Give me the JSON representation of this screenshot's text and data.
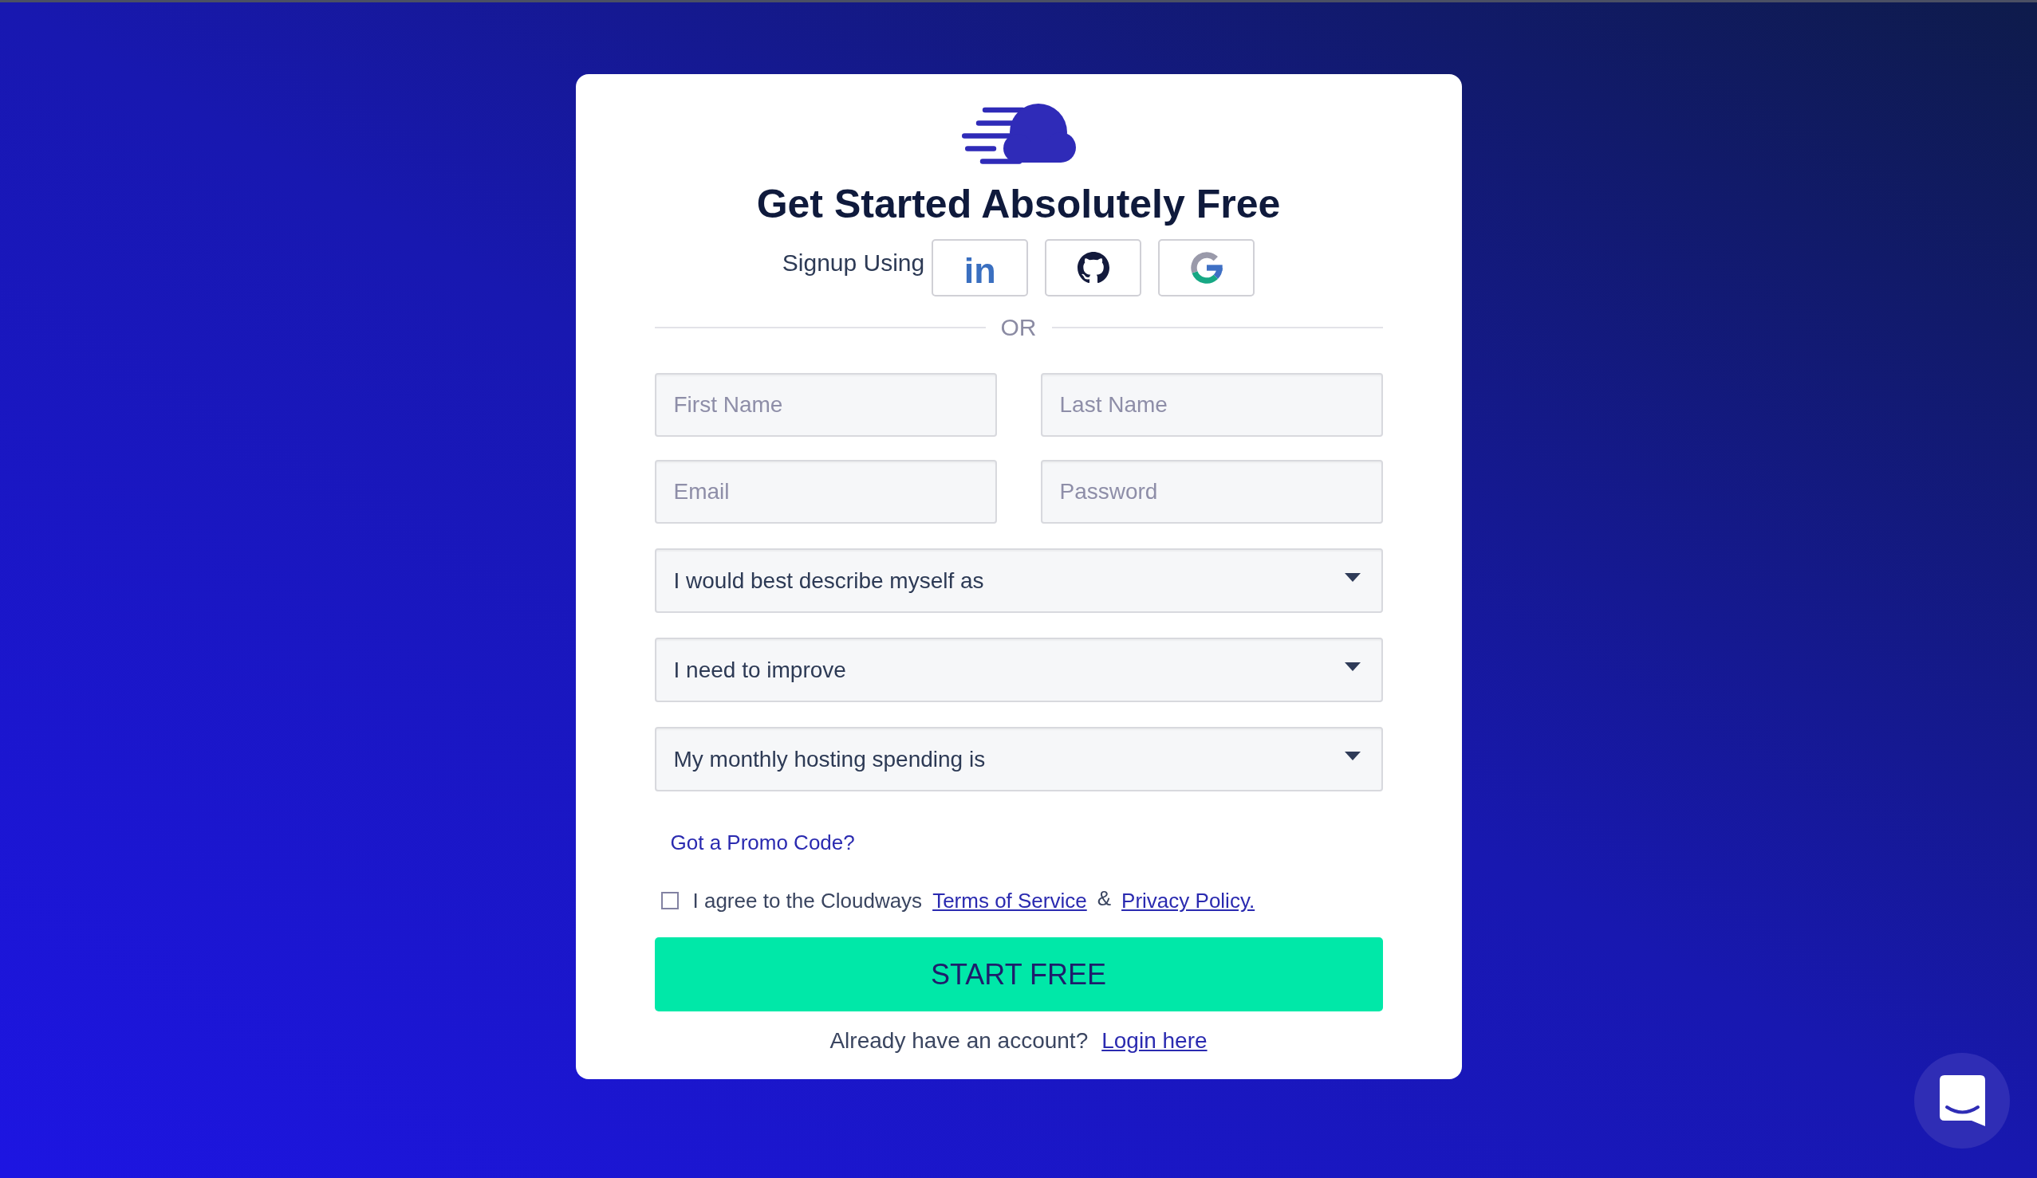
{
  "title": "Get Started Absolutely Free",
  "signup_with": {
    "label": "Signup Using",
    "providers": [
      {
        "kind": "linkedin",
        "label": "in"
      },
      {
        "kind": "github"
      },
      {
        "kind": "google"
      }
    ]
  },
  "separator": "OR",
  "fields": [
    {
      "placeholder": "First Name"
    },
    {
      "placeholder": "Last Name"
    },
    {
      "placeholder": "Email"
    },
    {
      "placeholder": "Password"
    }
  ],
  "dropdowns": [
    {
      "value": "I would best describe myself as"
    },
    {
      "value": "I need to improve"
    },
    {
      "value": "My monthly hosting spending is"
    }
  ],
  "promo_link": "Got a Promo Code?",
  "agreement": {
    "checked": false,
    "text": "I agree to the Cloudways",
    "terms_link": "Terms of Service",
    "joiner": "&",
    "privacy_link": "Privacy Policy."
  },
  "submit_button": "START FREE",
  "login_prompt": {
    "text": "Already have an account?",
    "link": "Login here"
  }
}
